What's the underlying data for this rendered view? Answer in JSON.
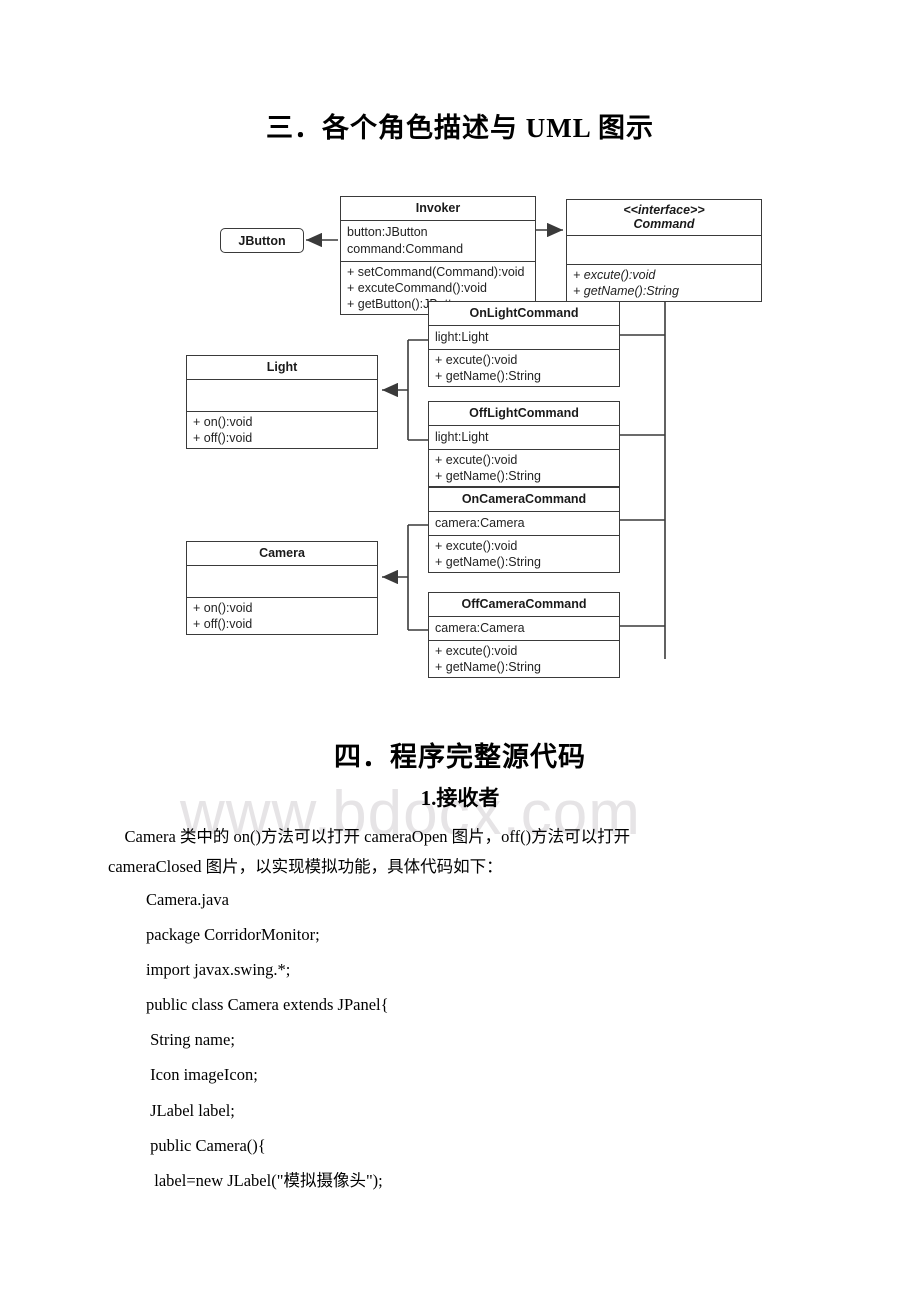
{
  "document": {
    "headings": {
      "section3": "三．各个角色描述与 UML 图示",
      "section4": "四．程序完整源代码",
      "subsection1": "1.接收者"
    },
    "watermark": "www.bdocx.com",
    "paragraphs": [
      "    Camera 类中的 on()方法可以打开 cameraOpen 图片，off()方法可以打开",
      "cameraClosed 图片，以实现模拟功能，具体代码如下："
    ],
    "code_lines": [
      "Camera.java",
      "package CorridorMonitor;",
      "import javax.swing.*;",
      "public class Camera extends JPanel{",
      " String name;",
      " Icon imageIcon;",
      " JLabel label;",
      " public Camera(){",
      "  label=new JLabel(\"模拟摄像头\");"
    ]
  },
  "uml": {
    "classes": {
      "jbutton": {
        "name": "JButton"
      },
      "invoker": {
        "name": "Invoker",
        "attributes": [
          "button:JButton",
          "command:Command"
        ],
        "operations": [
          "+ setCommand(Command):void",
          "+ excuteCommand():void",
          "+ getButton():JButton"
        ]
      },
      "command": {
        "stereotype": "<<interface>>",
        "name": "Command",
        "attributes": [],
        "operations": [
          "+ excute():void",
          "+ getName():String"
        ]
      },
      "onLightCommand": {
        "name": "OnLightCommand",
        "attributes": [
          "light:Light"
        ],
        "operations": [
          "+ excute():void",
          "+ getName():String"
        ]
      },
      "offLightCommand": {
        "name": "OffLightCommand",
        "attributes": [
          "light:Light"
        ],
        "operations": [
          "+ excute():void",
          "+ getName():String"
        ]
      },
      "onCameraCommand": {
        "name": "OnCameraCommand",
        "attributes": [
          "camera:Camera"
        ],
        "operations": [
          "+ excute():void",
          "+ getName():String"
        ]
      },
      "offCameraCommand": {
        "name": "OffCameraCommand",
        "attributes": [
          "camera:Camera"
        ],
        "operations": [
          "+ excute():void",
          "+ getName():String"
        ]
      },
      "light": {
        "name": "Light",
        "attributes": [],
        "operations": [
          "+ on():void",
          "+ off():void"
        ]
      },
      "camera": {
        "name": "Camera",
        "attributes": [],
        "operations": [
          "+ on():void",
          "+ off():void"
        ]
      }
    },
    "colors": {
      "line": "#3a3a3a",
      "text": "#1a1a1a",
      "watermark": "#e6e4e6"
    }
  }
}
